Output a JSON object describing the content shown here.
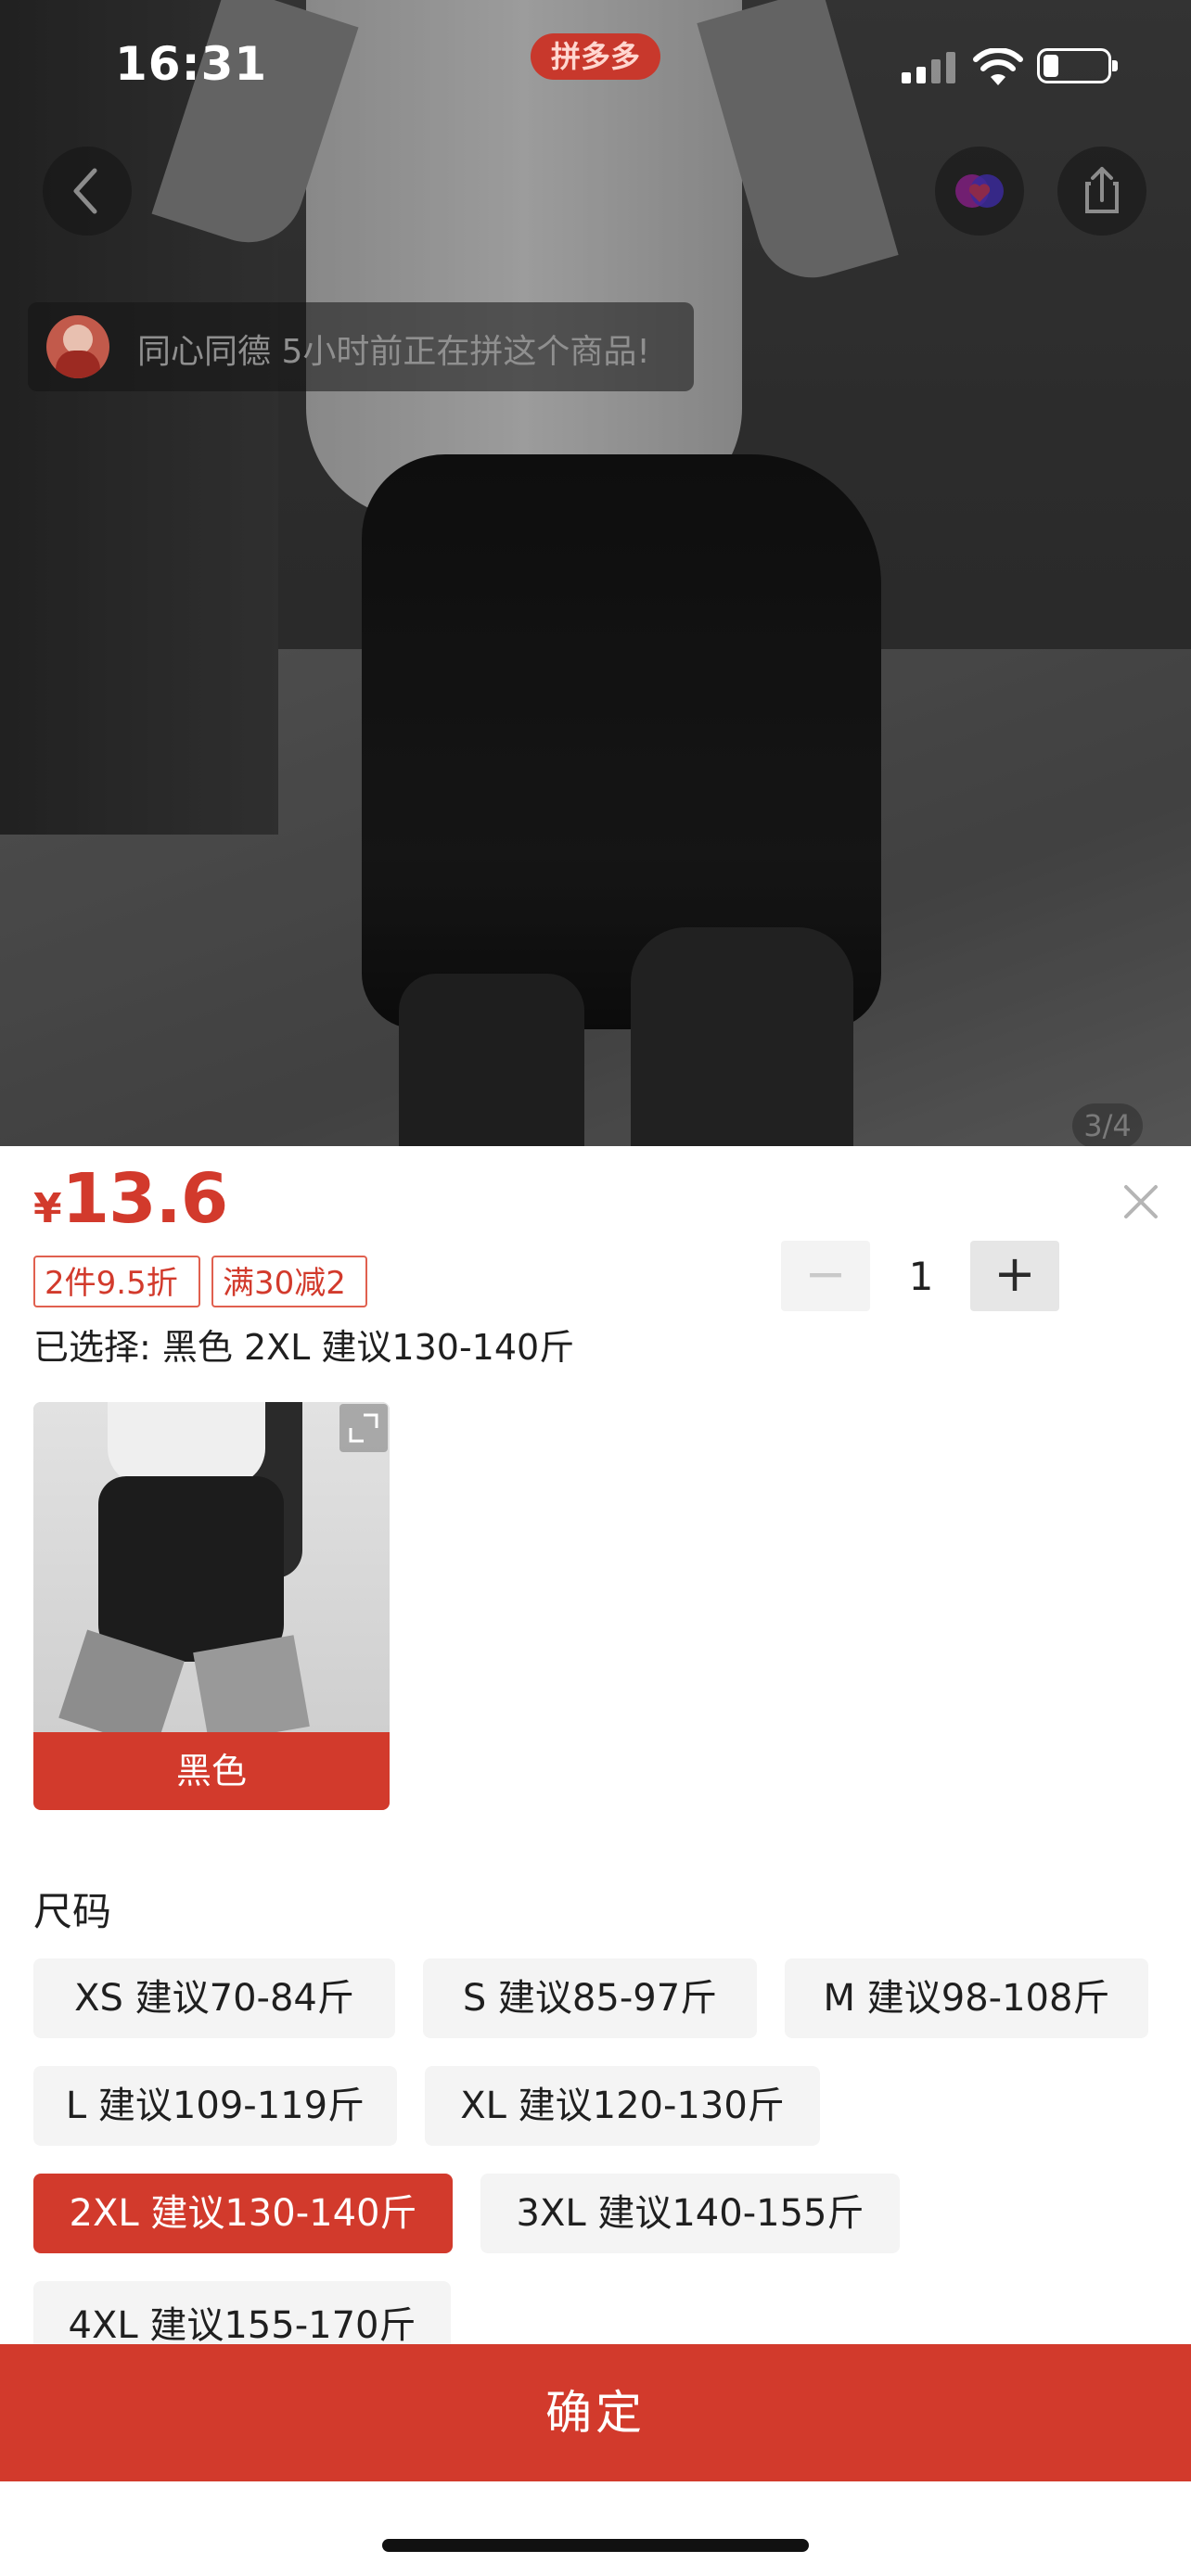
{
  "status_bar": {
    "time": "16:31",
    "app_badge": "拼多多"
  },
  "nav": {
    "back_icon": "chevron-left-icon",
    "favorite_icon": "heart-icon",
    "share_icon": "share-icon"
  },
  "ticker": {
    "text": "同心同德 5小时前正在拼这个商品!"
  },
  "image_counter": "3/4",
  "product": {
    "currency": "¥",
    "price": "13.6",
    "coupons": [
      "2件9.5折",
      "满30减2"
    ],
    "selected": "已选择: 黑色 2XL 建议130-140斤"
  },
  "quantity": {
    "minus": "−",
    "value": "1",
    "plus": "+"
  },
  "color_option": {
    "label": "黑色"
  },
  "sizes": {
    "title": "尺码",
    "options": [
      "XS 建议70-84斤",
      "S 建议85-97斤",
      "M 建议98-108斤",
      "L 建议109-119斤",
      "XL 建议120-130斤",
      "2XL 建议130-140斤",
      "3XL 建议140-155斤",
      "4XL 建议155-170斤"
    ],
    "selected": "2XL 建议130-140斤"
  },
  "confirm_label": "确定",
  "colors": {
    "accent": "#d23a2c"
  }
}
